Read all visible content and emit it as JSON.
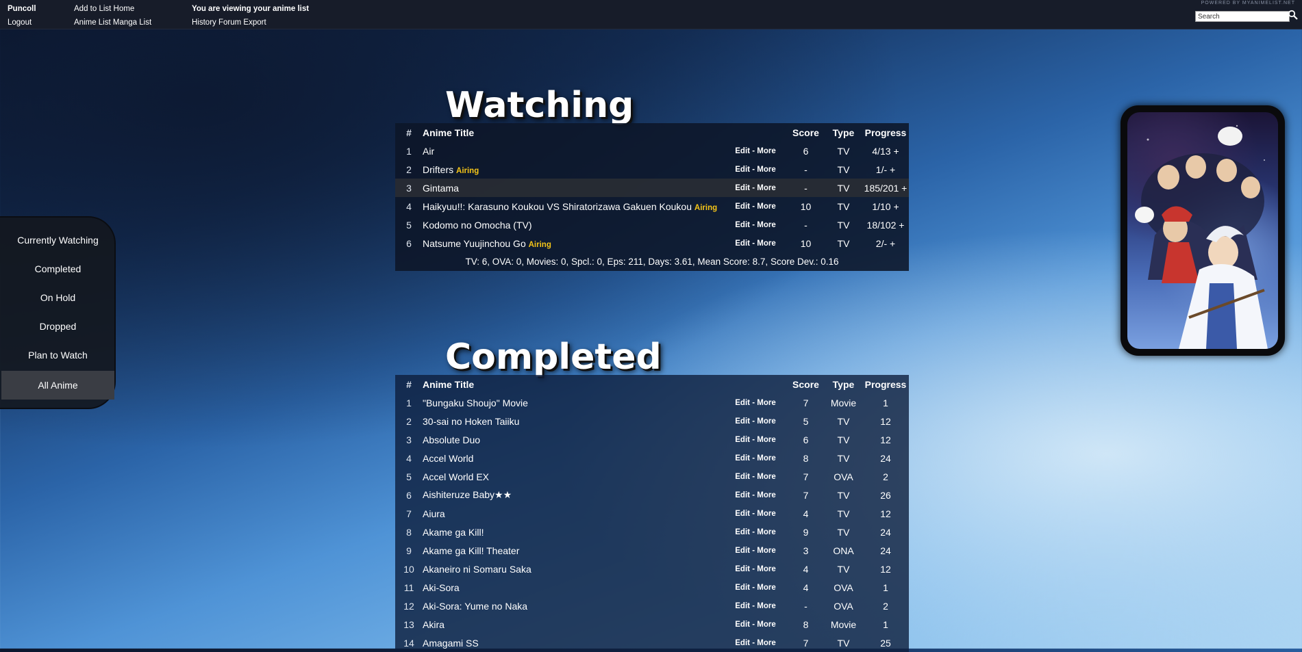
{
  "topbar": {
    "user": "Puncoll",
    "logout": "Logout",
    "add_to_list": "Add to List",
    "home": "Home",
    "anime_list": "Anime List",
    "manga_list": "Manga List",
    "viewing_msg": "You are viewing your anime list",
    "history": "History",
    "forum": "Forum",
    "export": "Export",
    "powered_by": "POWERED BY MYANIMELIST.NET",
    "search_value": "Search"
  },
  "sidenav": {
    "items": [
      "Currently Watching",
      "Completed",
      "On Hold",
      "Dropped",
      "Plan to Watch",
      "All Anime"
    ],
    "active": "All Anime"
  },
  "headers": {
    "num": "#",
    "title": "Anime Title",
    "score": "Score",
    "type": "Type",
    "progress": "Progress"
  },
  "edit_label": "Edit",
  "more_label": "More",
  "airing_label": "Airing",
  "watching": {
    "title": "Watching",
    "rows": [
      {
        "num": "1",
        "title": "Air",
        "airing": false,
        "score": "6",
        "type": "TV",
        "progress": "4/13",
        "inc": "+"
      },
      {
        "num": "2",
        "title": "Drifters",
        "airing": true,
        "score": "-",
        "type": "TV",
        "progress": "1/-",
        "inc": "+"
      },
      {
        "num": "3",
        "title": "Gintama",
        "airing": false,
        "score": "-",
        "type": "TV",
        "progress": "185/201",
        "inc": "+"
      },
      {
        "num": "4",
        "title": "Haikyuu!!: Karasuno Koukou VS Shiratorizawa Gakuen Koukou",
        "airing": true,
        "score": "10",
        "type": "TV",
        "progress": "1/10",
        "inc": "+"
      },
      {
        "num": "5",
        "title": "Kodomo no Omocha (TV)",
        "airing": false,
        "score": "-",
        "type": "TV",
        "progress": "18/102",
        "inc": "+"
      },
      {
        "num": "6",
        "title": "Natsume Yuujinchou Go",
        "airing": true,
        "score": "10",
        "type": "TV",
        "progress": "2/-",
        "inc": "+"
      }
    ],
    "stats": "TV: 6, OVA: 0, Movies: 0, Spcl.: 0, Eps: 211, Days: 3.61, Mean Score: 8.7, Score Dev.: 0.16"
  },
  "completed": {
    "title": "Completed",
    "rows": [
      {
        "num": "1",
        "title": "\"Bungaku Shoujo\" Movie",
        "score": "7",
        "type": "Movie",
        "progress": "1"
      },
      {
        "num": "2",
        "title": "30-sai no Hoken Taiiku",
        "score": "5",
        "type": "TV",
        "progress": "12"
      },
      {
        "num": "3",
        "title": "Absolute Duo",
        "score": "6",
        "type": "TV",
        "progress": "12"
      },
      {
        "num": "4",
        "title": "Accel World",
        "score": "8",
        "type": "TV",
        "progress": "24"
      },
      {
        "num": "5",
        "title": "Accel World EX",
        "score": "7",
        "type": "OVA",
        "progress": "2"
      },
      {
        "num": "6",
        "title": "Aishiteruze Baby★★",
        "score": "7",
        "type": "TV",
        "progress": "26"
      },
      {
        "num": "7",
        "title": "Aiura",
        "score": "4",
        "type": "TV",
        "progress": "12"
      },
      {
        "num": "8",
        "title": "Akame ga Kill!",
        "score": "9",
        "type": "TV",
        "progress": "24"
      },
      {
        "num": "9",
        "title": "Akame ga Kill! Theater",
        "score": "3",
        "type": "ONA",
        "progress": "24"
      },
      {
        "num": "10",
        "title": "Akaneiro ni Somaru Saka",
        "score": "4",
        "type": "TV",
        "progress": "12"
      },
      {
        "num": "11",
        "title": "Aki-Sora",
        "score": "4",
        "type": "OVA",
        "progress": "1"
      },
      {
        "num": "12",
        "title": "Aki-Sora: Yume no Naka",
        "score": "-",
        "type": "OVA",
        "progress": "2"
      },
      {
        "num": "13",
        "title": "Akira",
        "score": "8",
        "type": "Movie",
        "progress": "1"
      },
      {
        "num": "14",
        "title": "Amagami SS",
        "score": "7",
        "type": "TV",
        "progress": "25"
      }
    ]
  }
}
